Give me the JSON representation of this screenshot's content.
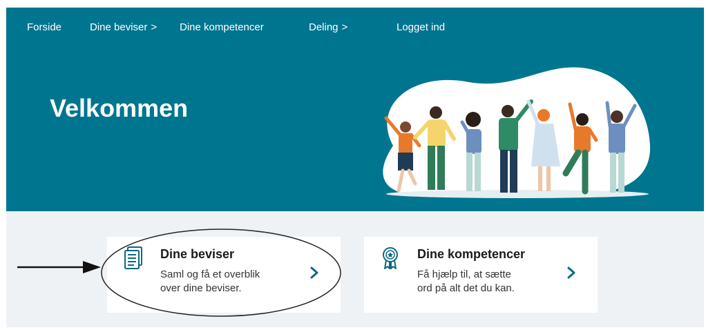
{
  "nav": {
    "items": [
      {
        "label": "Forside",
        "chevron": ""
      },
      {
        "label": "Dine beviser",
        "chevron": ">"
      },
      {
        "label": "Dine kompetencer",
        "chevron": ""
      },
      {
        "label": "Deling",
        "chevron": ">"
      },
      {
        "label": "Logget ind",
        "chevron": ""
      }
    ]
  },
  "hero": {
    "title": "Velkommen"
  },
  "cards": [
    {
      "title": "Dine beviser",
      "description_line1": "Saml og få et overblik",
      "description_line2": "over dine beviser.",
      "icon": "documents-icon"
    },
    {
      "title": "Dine kompetencer",
      "description_line1": "Få hjælp til, at sætte",
      "description_line2": "ord på alt det du kan.",
      "icon": "award-ribbon-icon"
    }
  ],
  "colors": {
    "hero_background": "#00758f",
    "lower_background": "#eef2f5",
    "accent": "#0b6785",
    "card_background": "#ffffff"
  }
}
